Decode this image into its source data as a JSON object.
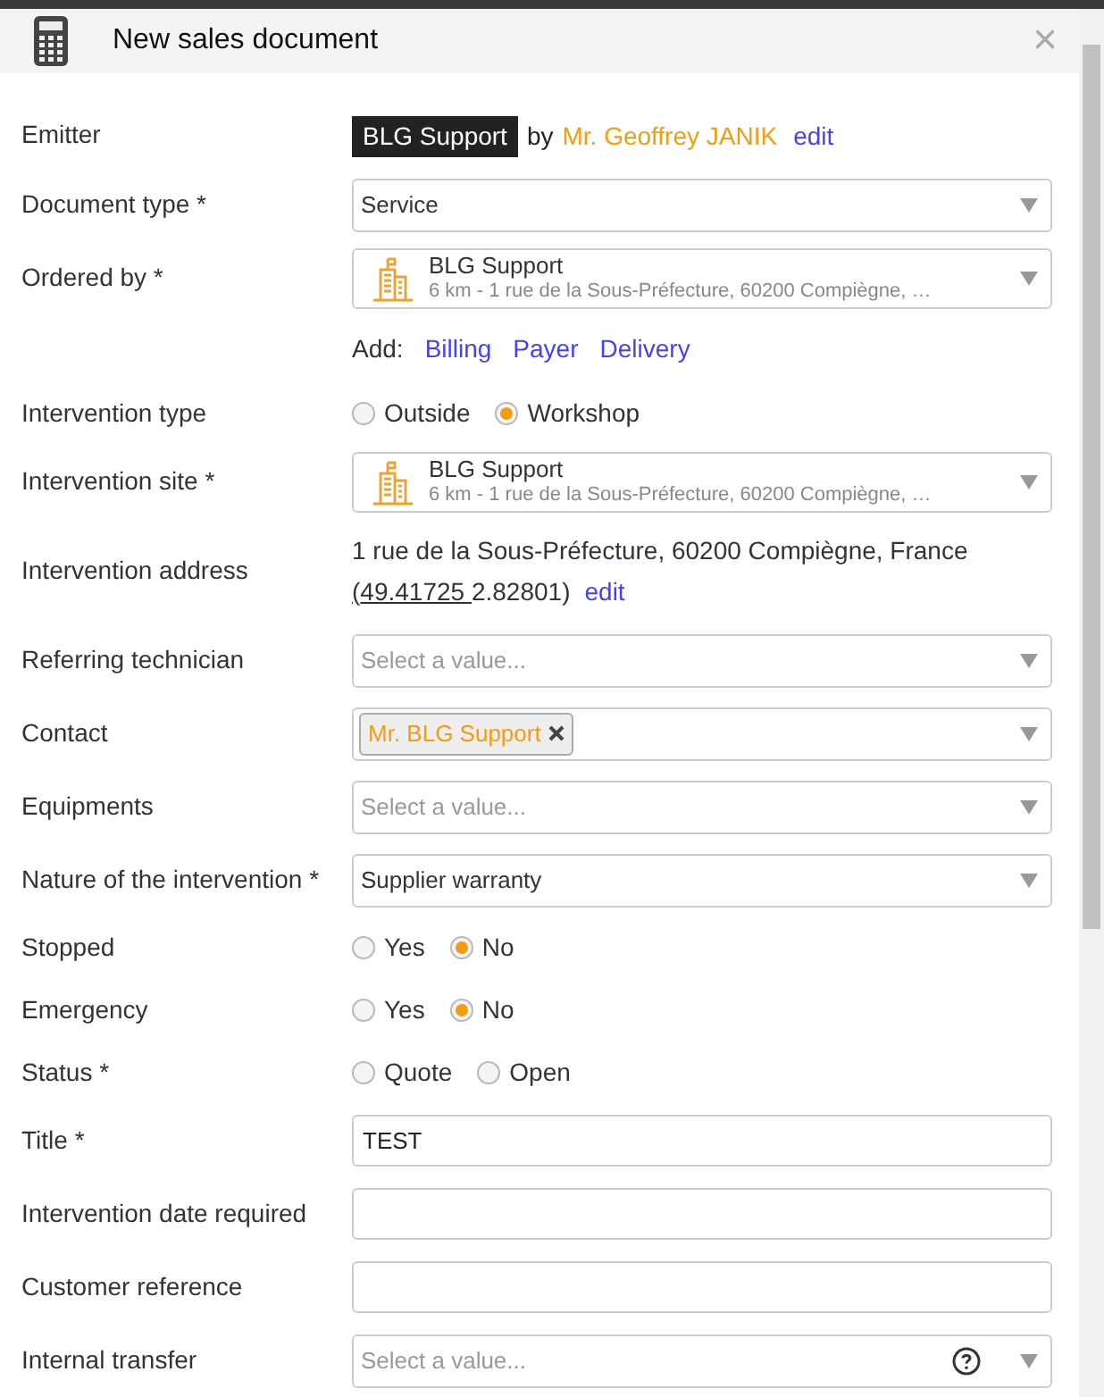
{
  "window": {
    "title": "New sales document",
    "close": "×"
  },
  "fields": [
    {
      "kind": "emitter",
      "label": "Emitter",
      "badge": "BLG Support",
      "by": "by",
      "person": "Mr. Geoffrey JANIK",
      "link": "edit"
    },
    {
      "kind": "select",
      "label": "Document type *",
      "value": "Service"
    },
    {
      "kind": "place",
      "label": "Ordered by *",
      "name": "BLG Support",
      "detail": "6 km - 1 rue de la Sous-Préfecture, 60200 Compiègne, …"
    },
    {
      "kind": "links",
      "label": "Add:",
      "links": [
        "Billing",
        "Payer",
        "Delivery"
      ]
    },
    {
      "kind": "radio",
      "label": "Intervention type",
      "options": [
        {
          "label": "Outside",
          "selected": false
        },
        {
          "label": "Workshop",
          "selected": true
        }
      ]
    },
    {
      "kind": "place",
      "label": "Intervention site *",
      "name": "BLG Support",
      "detail": "6 km - 1 rue de la Sous-Préfecture, 60200 Compiègne, …"
    },
    {
      "kind": "address",
      "label": "Intervention address",
      "line": "1 rue de la Sous-Préfecture, 60200 Compiègne, France",
      "coords_open": "(",
      "lat": "49.41725 ",
      "lon": "2.82801)",
      "link": "edit"
    },
    {
      "kind": "select",
      "label": "Referring technician",
      "placeholder": "Select a value..."
    },
    {
      "kind": "tags",
      "label": "Contact",
      "tags": [
        "Mr. BLG Support"
      ]
    },
    {
      "kind": "select",
      "label": "Equipments",
      "placeholder": "Select a value..."
    },
    {
      "kind": "select",
      "label": "Nature of the intervention *",
      "value": "Supplier warranty"
    },
    {
      "kind": "radio",
      "label": "Stopped",
      "options": [
        {
          "label": "Yes",
          "selected": false
        },
        {
          "label": "No",
          "selected": true
        }
      ]
    },
    {
      "kind": "radio",
      "label": "Emergency",
      "options": [
        {
          "label": "Yes",
          "selected": false
        },
        {
          "label": "No",
          "selected": true
        }
      ]
    },
    {
      "kind": "radio",
      "label": "Status *",
      "options": [
        {
          "label": "Quote",
          "selected": false
        },
        {
          "label": "Open",
          "selected": false
        }
      ]
    },
    {
      "kind": "input",
      "label": "Title *",
      "value": "TEST"
    },
    {
      "kind": "input",
      "label": "Intervention date required"
    },
    {
      "kind": "input",
      "label": "Customer reference"
    },
    {
      "kind": "select",
      "label": "Internal transfer",
      "placeholder": "Select a value...",
      "help": true
    }
  ]
}
